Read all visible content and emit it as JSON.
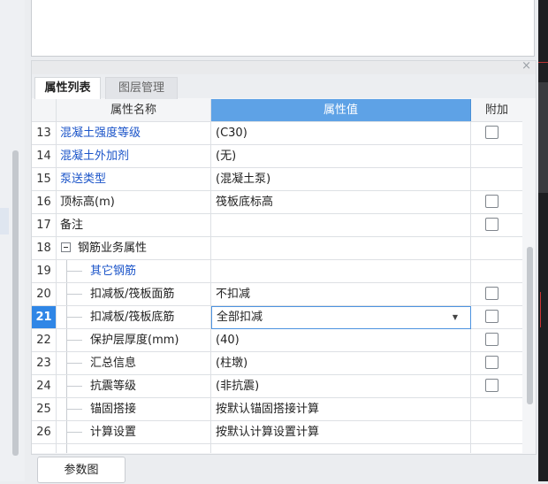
{
  "tabs": {
    "properties": "属性列表",
    "layers": "图层管理"
  },
  "close_label": "×",
  "table": {
    "headers": {
      "name": "属性名称",
      "value": "属性值",
      "add": "附加"
    },
    "rows": [
      {
        "num": "13",
        "name": "混凝土强度等级",
        "value": "(C30)"
      },
      {
        "num": "14",
        "name": "混凝土外加剂",
        "value": "(无)"
      },
      {
        "num": "15",
        "name": "泵送类型",
        "value": "(混凝土泵)"
      },
      {
        "num": "16",
        "name": "顶标高(m)",
        "value": "筏板底标高"
      },
      {
        "num": "17",
        "name": "备注",
        "value": ""
      },
      {
        "num": "18",
        "name": "钢筋业务属性",
        "value": ""
      },
      {
        "num": "19",
        "name": "其它钢筋",
        "value": ""
      },
      {
        "num": "20",
        "name": "扣减板/筏板面筋",
        "value": "不扣减"
      },
      {
        "num": "21",
        "name": "扣减板/筏板底筋",
        "value": "全部扣减"
      },
      {
        "num": "22",
        "name": "保护层厚度(mm)",
        "value": "(40)"
      },
      {
        "num": "23",
        "name": "汇总信息",
        "value": "(柱墩)"
      },
      {
        "num": "24",
        "name": "抗震等级",
        "value": "(非抗震)"
      },
      {
        "num": "25",
        "name": "锚固搭接",
        "value": "按默认锚固搭接计算"
      },
      {
        "num": "26",
        "name": "计算设置",
        "value": "按默认计算设置计算"
      }
    ]
  },
  "colors": {
    "link": "#1c55c9",
    "header_value_bg": "#5ea2e6",
    "selected_row_num": "#2f86e6"
  },
  "icons": {
    "dropdown": "caret-down-icon",
    "expander": "collapse-minus-icon",
    "close": "close-icon"
  },
  "buttons": {
    "param_diagram": "参数图"
  }
}
